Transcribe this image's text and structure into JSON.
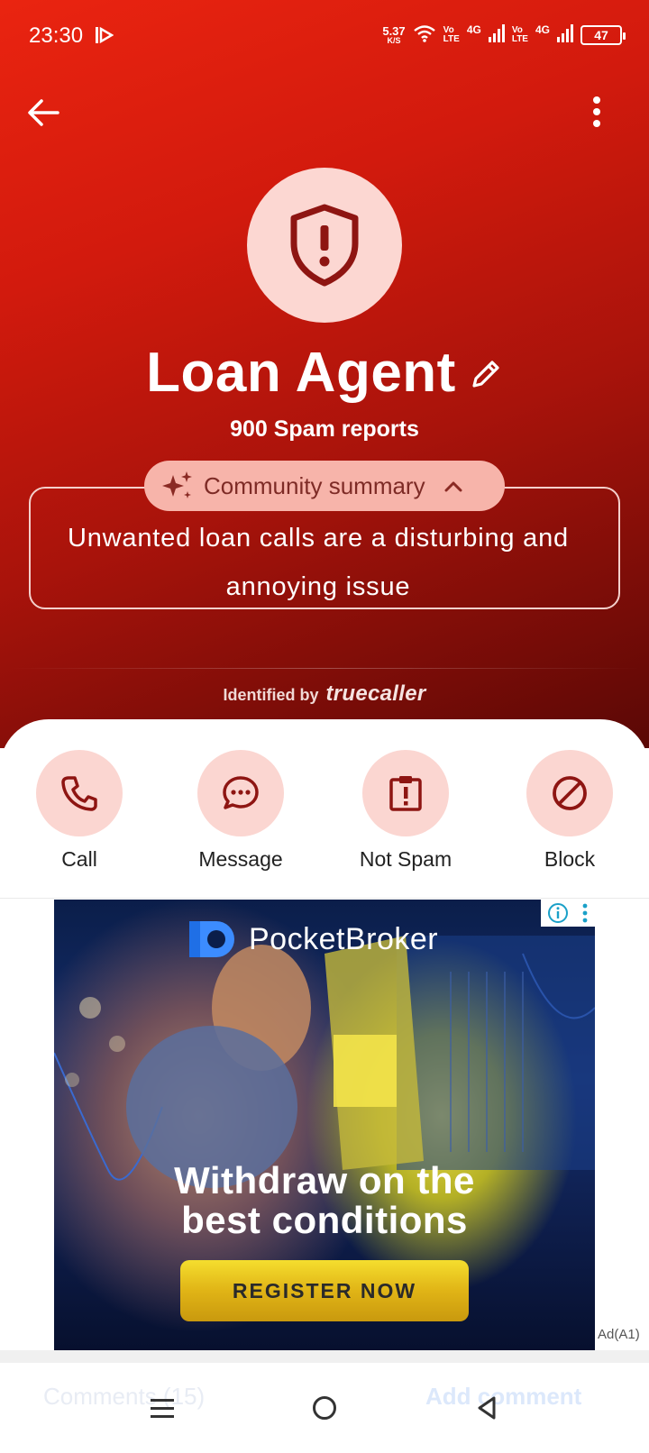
{
  "status_bar": {
    "time": "23:30",
    "speed_value": "5.37",
    "speed_unit": "K/S",
    "sim1_top": "Vo",
    "sim1_bottom": "LTE",
    "sim1_gen": "4G",
    "sim2_top": "Vo",
    "sim2_bottom": "LTE",
    "sim2_gen": "4G",
    "battery": "47"
  },
  "header": {
    "back_icon": "arrow-left-icon",
    "more_icon": "more-vertical-icon"
  },
  "profile": {
    "avatar_icon": "shield-alert-icon",
    "name": "Loan Agent",
    "edit_icon": "pencil-icon",
    "spam_reports": "900 Spam reports"
  },
  "summary": {
    "pill_label": "Community summary",
    "text": "Unwanted loan calls are a disturbing and annoying issue"
  },
  "identified": {
    "label": "Identified by",
    "brand": "truecaller"
  },
  "actions": [
    {
      "label": "Call",
      "icon": "phone-icon"
    },
    {
      "label": "Message",
      "icon": "chat-icon"
    },
    {
      "label": "Not Spam",
      "icon": "clipboard-alert-icon"
    },
    {
      "label": "Block",
      "icon": "block-icon"
    }
  ],
  "ad": {
    "brand": "PocketBroker",
    "headline_line1": "Withdraw on the",
    "headline_line2": "best conditions",
    "cta": "REGISTER NOW",
    "tag": "Ad(A1)"
  },
  "bottom": {
    "comments": "Comments (15)",
    "add_comment": "Add comment"
  },
  "colors": {
    "hero_top": "#ea2410",
    "hero_bottom": "#5a0805",
    "accent_soft": "#fbd6d1",
    "icon_dark_red": "#8e1512",
    "pill_bg": "#f7b4aa"
  }
}
